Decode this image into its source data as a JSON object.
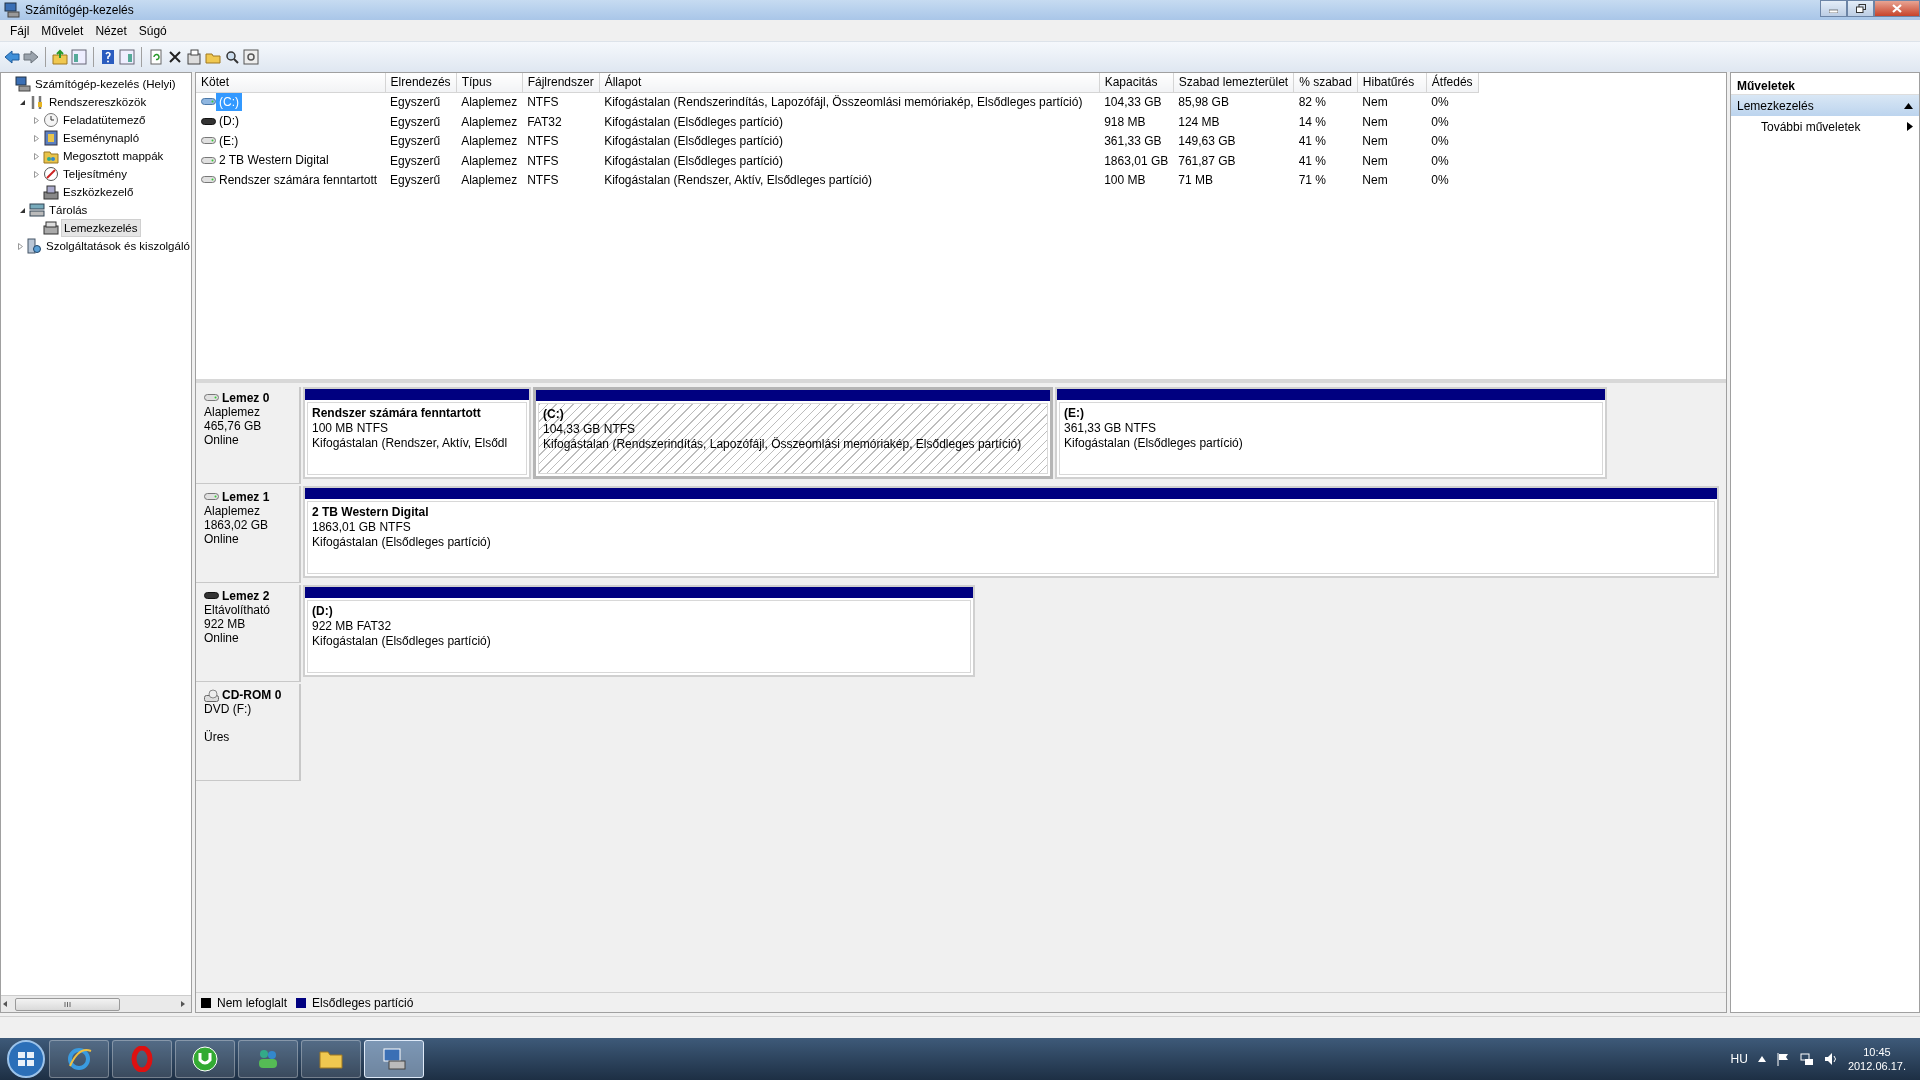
{
  "window": {
    "title": "Számítógép-kezelés"
  },
  "menu": [
    "Fájl",
    "Művelet",
    "Nézet",
    "Súgó"
  ],
  "tree": [
    {
      "label": "Számítógép-kezelés (Helyi)",
      "kind": "computer",
      "selected": false,
      "children": [
        {
          "label": "Rendszereszközök",
          "kind": "tools",
          "selected": false,
          "expanded": true,
          "children": [
            {
              "label": "Feladatütemező",
              "kind": "clock",
              "selected": false,
              "expanded": false
            },
            {
              "label": "Eseménynapló",
              "kind": "log",
              "selected": false,
              "expanded": false
            },
            {
              "label": "Megosztott mappák",
              "kind": "share",
              "selected": false,
              "expanded": false
            },
            {
              "label": "Teljesítmény",
              "kind": "perf",
              "selected": false,
              "expanded": false
            },
            {
              "label": "Eszközkezelő",
              "kind": "devices",
              "selected": false
            }
          ]
        },
        {
          "label": "Tárolás",
          "kind": "storage",
          "selected": false,
          "expanded": true,
          "children": [
            {
              "label": "Lemezkezelés",
              "kind": "diskmgmt",
              "selected": true
            }
          ]
        },
        {
          "label": "Szolgáltatások és kiszolgáló",
          "kind": "services",
          "selected": false,
          "expanded": false
        }
      ]
    }
  ],
  "table": {
    "columns": [
      "Kötet",
      "Elrendezés",
      "Típus",
      "Fájlrendszer",
      "Állapot",
      "Kapacitás",
      "Szabad lemezterület",
      "% szabad",
      "Hibatűrés",
      "Átfedés"
    ],
    "rows": [
      {
        "kind": "system",
        "selected": true,
        "cells": [
          "(C:)",
          "Egyszerű",
          "Alaplemez",
          "NTFS",
          "Kifogástalan (Rendszerindítás, Lapozófájl, Összeomlási memóriakép, Elsődleges partíció)",
          "104,33 GB",
          "85,98 GB",
          "82 %",
          "Nem",
          "0%"
        ]
      },
      {
        "kind": "removable",
        "selected": false,
        "cells": [
          "(D:)",
          "Egyszerű",
          "Alaplemez",
          "FAT32",
          "Kifogástalan (Elsődleges partíció)",
          "918 MB",
          "124 MB",
          "14 %",
          "Nem",
          "0%"
        ]
      },
      {
        "kind": "basic",
        "selected": false,
        "cells": [
          "(E:)",
          "Egyszerű",
          "Alaplemez",
          "NTFS",
          "Kifogástalan (Elsődleges partíció)",
          "361,33 GB",
          "149,63 GB",
          "41 %",
          "Nem",
          "0%"
        ]
      },
      {
        "kind": "basic",
        "selected": false,
        "cells": [
          "2 TB Western Digital",
          "Egyszerű",
          "Alaplemez",
          "NTFS",
          "Kifogástalan (Elsődleges partíció)",
          "1863,01 GB",
          "761,87 GB",
          "41 %",
          "Nem",
          "0%"
        ]
      },
      {
        "kind": "basic",
        "selected": false,
        "cells": [
          "Rendszer számára fenntartott",
          "Egyszerű",
          "Alaplemez",
          "NTFS",
          "Kifogástalan (Rendszer, Aktív, Elsődleges partíció)",
          "100 MB",
          "71 MB",
          "71 %",
          "Nem",
          "0%"
        ]
      }
    ]
  },
  "disks": [
    {
      "kind": "basic",
      "name": "Lemez 0",
      "type": "Alaplemez",
      "size": "465,76 GB",
      "status": "Online",
      "partitions": [
        {
          "name": "Rendszer számára fenntartott",
          "size": "100 MB NTFS",
          "status": "Kifogástalan (Rendszer, Aktív, Elsődl",
          "selected": false
        },
        {
          "name": "(C:)",
          "size": "104,33 GB NTFS",
          "status": "Kifogástalan (Rendszerindítás, Lapozófájl, Összeomlási memóriakép, Elsődleges partíció)",
          "selected": true
        },
        {
          "name": "(E:)",
          "size": "361,33 GB NTFS",
          "status": "Kifogástalan (Elsődleges partíció)",
          "selected": false
        }
      ]
    },
    {
      "kind": "basic",
      "name": "Lemez 1",
      "type": "Alaplemez",
      "size": "1863,02 GB",
      "status": "Online",
      "partitions": [
        {
          "name": "2 TB Western Digital",
          "size": "1863,01 GB NTFS",
          "status": "Kifogástalan (Elsődleges partíció)",
          "selected": false
        }
      ]
    },
    {
      "kind": "removable",
      "name": "Lemez 2",
      "type": "Eltávolítható",
      "size": "922 MB",
      "status": "Online",
      "partitions": [
        {
          "name": "(D:)",
          "size": "922 MB FAT32",
          "status": "Kifogástalan (Elsődleges partíció)",
          "selected": false
        }
      ]
    },
    {
      "kind": "cdrom",
      "name": "CD-ROM 0",
      "type": "DVD (F:)",
      "status": "Üres"
    }
  ],
  "legend": [
    {
      "label": "Nem lefoglalt",
      "color": "#000000"
    },
    {
      "label": "Elsődleges partíció",
      "color": "#000080"
    }
  ],
  "actions": {
    "title": "Műveletek",
    "sections": [
      {
        "label": "Lemezkezelés",
        "expanded": true,
        "items": [
          "További műveletek"
        ]
      }
    ]
  },
  "taskbar": {
    "apps": [
      {
        "kind": "globe",
        "selected": false
      },
      {
        "kind": "ring",
        "selected": false
      },
      {
        "kind": "utorrent",
        "selected": false
      },
      {
        "kind": "people",
        "selected": false
      },
      {
        "kind": "folder",
        "selected": false
      },
      {
        "kind": "computer",
        "selected": true
      }
    ],
    "language": "HU",
    "time": "10:45",
    "date": "2012.06.17."
  }
}
